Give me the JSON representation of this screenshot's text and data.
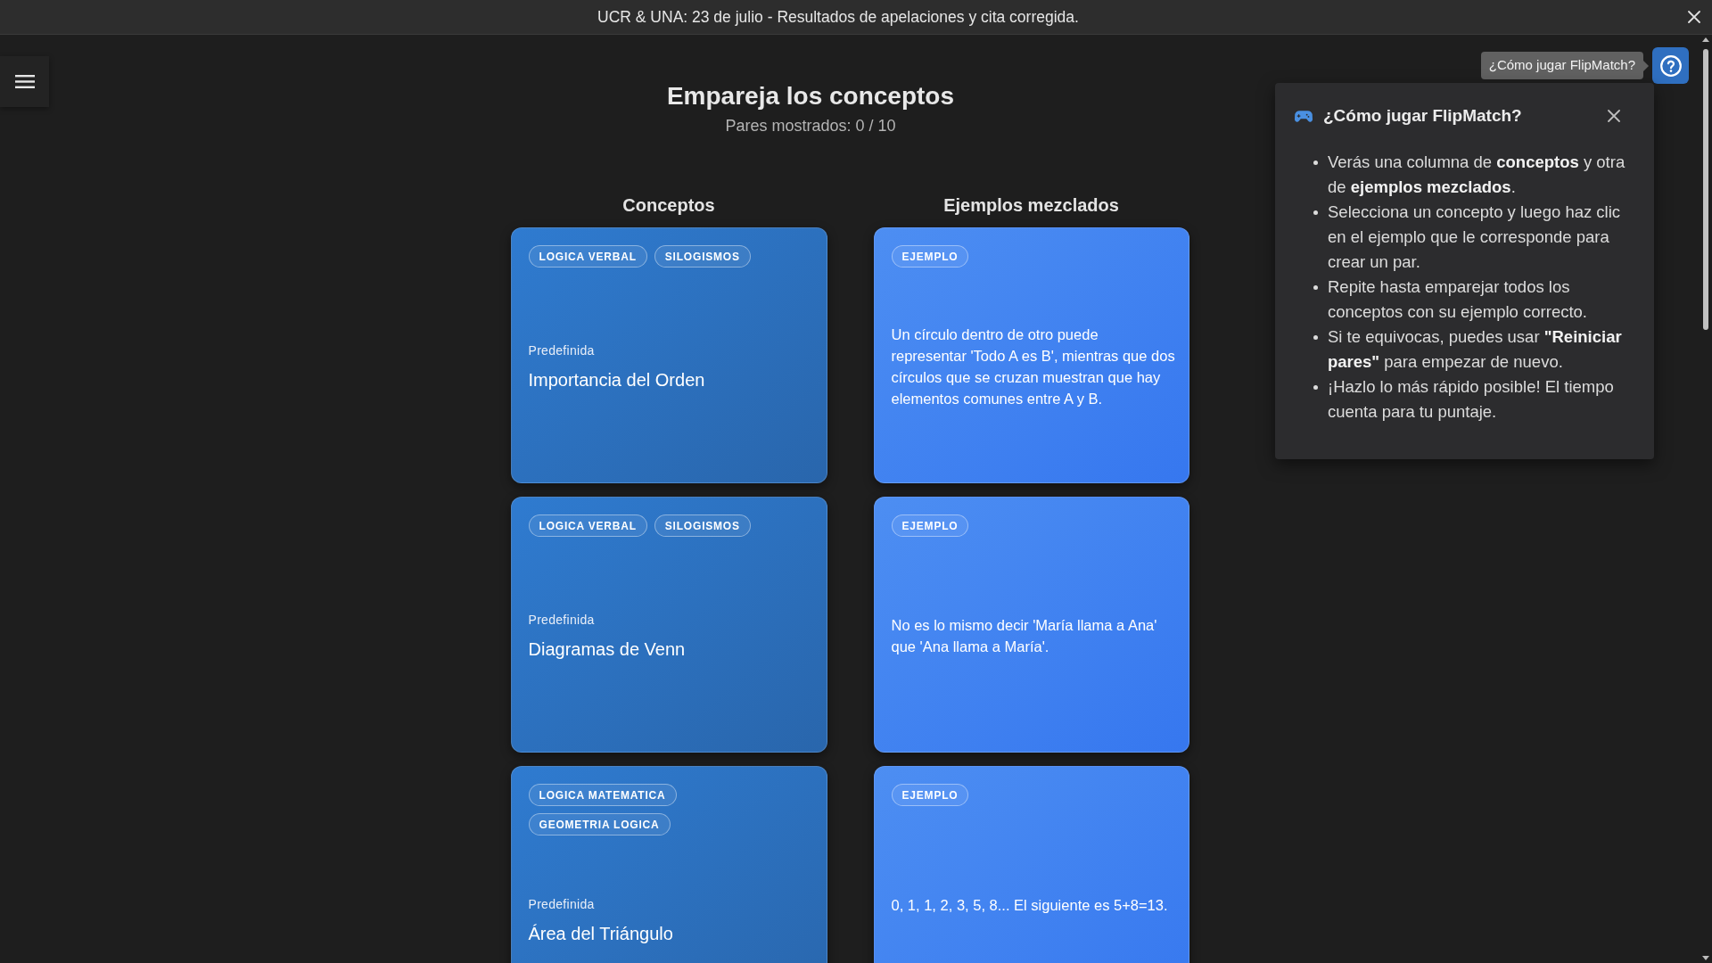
{
  "banner": {
    "text": "UCR & UNA: 23 de julio - Resultados de apelaciones y cita corregida."
  },
  "page": {
    "title": "Empareja los conceptos",
    "progress": "Pares mostrados: 0 / 10"
  },
  "concepts": {
    "heading": "Conceptos",
    "cards": [
      {
        "tags": [
          "LOGICA VERBAL",
          "SILOGISMOS"
        ],
        "source": "Predefinida",
        "title": "Importancia del Orden"
      },
      {
        "tags": [
          "LOGICA VERBAL",
          "SILOGISMOS"
        ],
        "source": "Predefinida",
        "title": "Diagramas de Venn"
      },
      {
        "tags": [
          "LOGICA MATEMATICA",
          "GEOMETRIA LOGICA"
        ],
        "source": "Predefinida",
        "title": "Área del Triángulo"
      }
    ]
  },
  "examples": {
    "heading": "Ejemplos mezclados",
    "cards": [
      {
        "tag": "EJEMPLO",
        "text": "Un círculo dentro de otro puede representar 'Todo A es B', mientras que dos círculos que se cruzan muestran que hay elementos comunes entre A y B."
      },
      {
        "tag": "EJEMPLO",
        "text": "No es lo mismo decir 'María llama a Ana' que 'Ana llama a María'."
      },
      {
        "tag": "EJEMPLO",
        "text": "0, 1, 1, 2, 3, 5, 8... El siguiente es 5+8=13."
      }
    ]
  },
  "help_button": {
    "tooltip": "¿Cómo jugar FlipMatch?"
  },
  "help_panel": {
    "title": "¿Cómo jugar FlipMatch?",
    "items": [
      "Verás una columna de **conceptos** y otra de **ejemplos mezclados**.",
      "Selecciona un concepto y luego haz clic en el ejemplo que le corresponde para crear un par.",
      "Repite hasta emparejar todos los conceptos con su ejemplo correcto.",
      "Si te equivocas, puedes usar **\"Reiniciar pares\"** para empezar de nuevo.",
      "¡Hazlo lo más rápido posible! El tiempo cuenta para tu puntaje."
    ]
  }
}
